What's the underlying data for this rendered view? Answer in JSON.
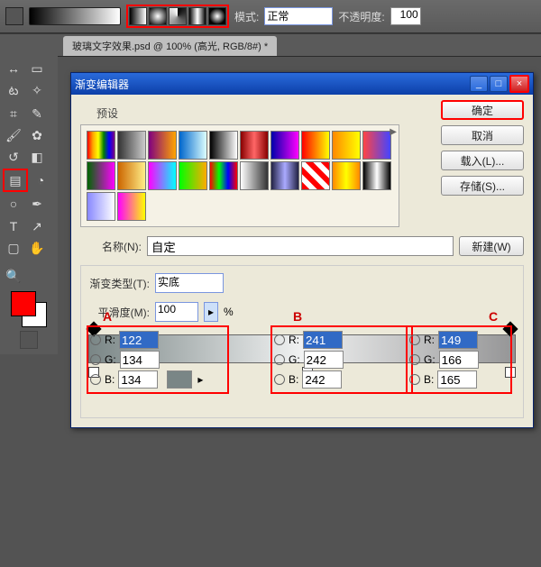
{
  "domain": "Computer-Use",
  "topbar": {
    "mode_label": "模式:",
    "mode_value": "正常",
    "opacity_label": "不透明度:",
    "opacity_value": "100",
    "gradient_types": [
      "linear",
      "radial",
      "angle",
      "reflected",
      "diamond"
    ]
  },
  "tab": {
    "title": "玻璃文字效果.psd @ 100% (高光, RGB/8#) *"
  },
  "tools": {
    "items": [
      [
        "move",
        "marquee"
      ],
      [
        "lasso",
        "wand"
      ],
      [
        "crop",
        "eyedropper"
      ],
      [
        "brush",
        "clone"
      ],
      [
        "history",
        "eraser"
      ],
      [
        "gradient",
        "blur"
      ],
      [
        "dodge",
        "pen"
      ],
      [
        "text",
        "path"
      ],
      [
        "shape",
        "hand"
      ],
      [
        "zoom",
        ""
      ]
    ],
    "glyphs": {
      "move": "↔",
      "marquee": "▭",
      "lasso": "ట",
      "wand": "✧",
      "crop": "⌗",
      "eyedropper": "✎",
      "brush": "🖌",
      "clone": "✿",
      "history": "↺",
      "eraser": "◧",
      "gradient": "▤",
      "blur": "◔",
      "dodge": "○",
      "pen": "✒",
      "text": "T",
      "path": "↗",
      "shape": "▢",
      "hand": "✋",
      "zoom": "🔍"
    },
    "active": "gradient",
    "foreground": "#ff0000",
    "background": "#ffffff"
  },
  "dialog": {
    "title": "渐变编辑器",
    "win_min": "_",
    "win_max": "□",
    "win_close": "×",
    "presets_label": "预设",
    "preset_swatches": [
      "linear-gradient(90deg,red,orange,yellow,green,blue,purple)",
      "linear-gradient(90deg,#333,#ccc)",
      "linear-gradient(90deg,purple,orange)",
      "linear-gradient(90deg,#06c,#dff)",
      "linear-gradient(90deg,#000,#fff)",
      "linear-gradient(90deg,#800,#f66,#800)",
      "linear-gradient(90deg,#00a,#f0f)",
      "linear-gradient(90deg,red,yellow)",
      "linear-gradient(90deg,#f80,#ff0)",
      "linear-gradient(90deg,#f44,#44f)",
      "linear-gradient(90deg,#060,#f0f)",
      "linear-gradient(90deg,#c60,#fe8)",
      "linear-gradient(90deg,#f0f,#0ff)",
      "linear-gradient(90deg,#0f0,#fa0)",
      "linear-gradient(90deg,red,lime,blue,red)",
      "linear-gradient(90deg,#fff,#333)",
      "linear-gradient(90deg,#224,#aaf,#224)",
      "repeating-linear-gradient(45deg,red 0 6px,#fff 6px 12px)",
      "linear-gradient(90deg,#f80,#ff0,#f80)",
      "linear-gradient(90deg,#000,#fff,#000)",
      "linear-gradient(90deg,#88f,#fff)",
      "linear-gradient(90deg,#f0f,#ff0)"
    ],
    "buttons": {
      "ok": "确定",
      "cancel": "取消",
      "load": "载入(L)...",
      "save": "存储(S)...",
      "new": "新建(W)"
    },
    "name_label": "名称(N):",
    "name_value": "自定",
    "type_label": "渐变类型(T):",
    "type_value": "实底",
    "smooth_label": "平滑度(M):",
    "smooth_value": "100",
    "smooth_unit": "%",
    "stops": {
      "labels": {
        "A": "A",
        "B": "B",
        "C": "C",
        "R": "R:",
        "G": "G:",
        "B_": "B:"
      },
      "A": {
        "R": "122",
        "G": "134",
        "B": "134"
      },
      "B": {
        "R": "241",
        "G": "242",
        "B": "242"
      },
      "C": {
        "R": "149",
        "G": "166",
        "B": "165"
      }
    }
  }
}
